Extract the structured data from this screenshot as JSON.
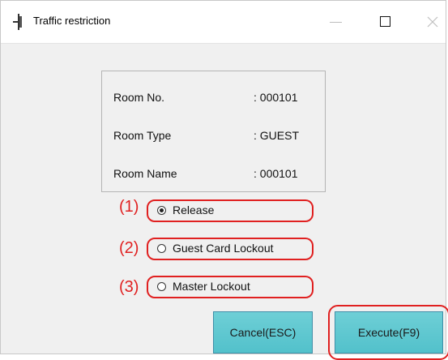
{
  "window": {
    "title": "Traffic restriction"
  },
  "info": {
    "rows": [
      {
        "label": "Room No.",
        "value": ": 000101"
      },
      {
        "label": "Room Type",
        "value": ": GUEST"
      },
      {
        "label": "Room Name",
        "value": ": 000101"
      }
    ]
  },
  "options": [
    {
      "num": "(1)",
      "label": "Release",
      "checked": true
    },
    {
      "num": "(2)",
      "label": "Guest Card Lockout",
      "checked": false
    },
    {
      "num": "(3)",
      "label": "Master Lockout",
      "checked": false
    }
  ],
  "buttons": {
    "cancel": "Cancel(ESC)",
    "execute": "Execute(F9)"
  },
  "colors": {
    "annotation": "#e02020",
    "button": "#5ec8d1"
  }
}
